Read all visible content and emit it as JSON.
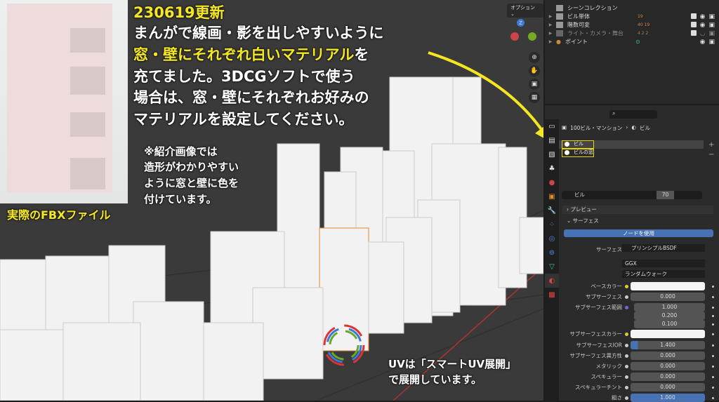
{
  "viewport": {
    "options_label": "オプション",
    "gizmo_z": "Z"
  },
  "overlay": {
    "date": "230619更新",
    "line1": "まんがで線画・影を出しやすいように",
    "line2_yellow": "窓・壁にそれぞれ白いマテリアル",
    "line2_rest": "を",
    "line3": "充てました。3DCGソフトで使う",
    "line4": "場合は、窓・壁にそれぞれお好みの",
    "line5": "マテリアルを設定してください。",
    "note": [
      "※紹介画像では",
      "造形がわかりやすい",
      "ように窓と壁に色を",
      "付けています。"
    ],
    "photo_caption": "実際のFBXファイル",
    "uv1": "UVは「スマートUV展開」",
    "uv2": "で展開しています。"
  },
  "outliner": {
    "root": "シーンコレクション",
    "items": [
      {
        "label": "ビル単体",
        "badge": "19"
      },
      {
        "label": "階数可変",
        "badge": "40 19"
      },
      {
        "label": "ライト・カメラ・舞台",
        "badge": "4 2 2"
      },
      {
        "label": "ポイント",
        "badge": ""
      }
    ]
  },
  "properties": {
    "breadcrumb_object": "100ビル・マンション",
    "breadcrumb_material": "ビル",
    "slots": [
      "ビル",
      "ビルの窓"
    ],
    "material_name": "ビル",
    "users": "70",
    "panels": {
      "preview": "プレビュー",
      "surface": "サーフェス"
    },
    "use_nodes": "ノードを使用",
    "surface_label": "サーフェス",
    "surface_value": "プリンシプルBSDF",
    "distribution": "GGX",
    "subsurface_method": "ランダムウォーク",
    "rows": [
      {
        "label": "ベースカラー",
        "value": ""
      },
      {
        "label": "サブサーフェス",
        "value": "0.000"
      },
      {
        "label": "サブサーフェス範囲",
        "value": "1.000"
      },
      {
        "label": "",
        "value": "0.200"
      },
      {
        "label": "",
        "value": "0.100"
      },
      {
        "label": "サブサーフェスカラー",
        "value": ""
      },
      {
        "label": "サブサーフェスIOR",
        "value": "1.400"
      },
      {
        "label": "サブサーフェス異方性",
        "value": "0.000"
      },
      {
        "label": "メタリック",
        "value": "0.000"
      },
      {
        "label": "スペキュラー",
        "value": "0.000"
      },
      {
        "label": "スペキュラーチント",
        "value": "0.000"
      },
      {
        "label": "粗さ",
        "value": "1.000"
      }
    ],
    "accent": "#4772b3"
  }
}
